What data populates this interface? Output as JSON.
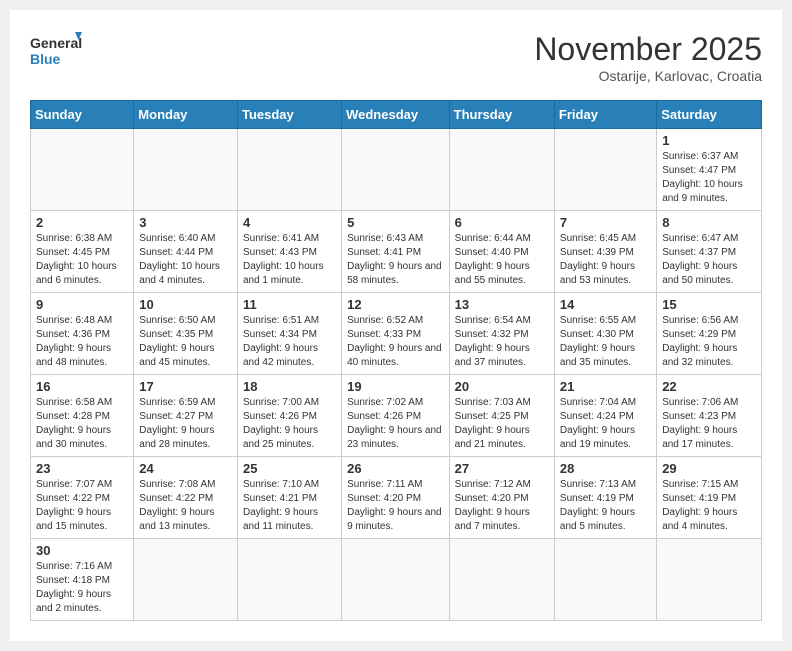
{
  "logo": {
    "text_general": "General",
    "text_blue": "Blue"
  },
  "header": {
    "month": "November 2025",
    "location": "Ostarije, Karlovac, Croatia"
  },
  "days_of_week": [
    "Sunday",
    "Monday",
    "Tuesday",
    "Wednesday",
    "Thursday",
    "Friday",
    "Saturday"
  ],
  "weeks": [
    [
      {
        "day": "",
        "info": ""
      },
      {
        "day": "",
        "info": ""
      },
      {
        "day": "",
        "info": ""
      },
      {
        "day": "",
        "info": ""
      },
      {
        "day": "",
        "info": ""
      },
      {
        "day": "",
        "info": ""
      },
      {
        "day": "1",
        "info": "Sunrise: 6:37 AM\nSunset: 4:47 PM\nDaylight: 10 hours and 9 minutes."
      }
    ],
    [
      {
        "day": "2",
        "info": "Sunrise: 6:38 AM\nSunset: 4:45 PM\nDaylight: 10 hours and 6 minutes."
      },
      {
        "day": "3",
        "info": "Sunrise: 6:40 AM\nSunset: 4:44 PM\nDaylight: 10 hours and 4 minutes."
      },
      {
        "day": "4",
        "info": "Sunrise: 6:41 AM\nSunset: 4:43 PM\nDaylight: 10 hours and 1 minute."
      },
      {
        "day": "5",
        "info": "Sunrise: 6:43 AM\nSunset: 4:41 PM\nDaylight: 9 hours and 58 minutes."
      },
      {
        "day": "6",
        "info": "Sunrise: 6:44 AM\nSunset: 4:40 PM\nDaylight: 9 hours and 55 minutes."
      },
      {
        "day": "7",
        "info": "Sunrise: 6:45 AM\nSunset: 4:39 PM\nDaylight: 9 hours and 53 minutes."
      },
      {
        "day": "8",
        "info": "Sunrise: 6:47 AM\nSunset: 4:37 PM\nDaylight: 9 hours and 50 minutes."
      }
    ],
    [
      {
        "day": "9",
        "info": "Sunrise: 6:48 AM\nSunset: 4:36 PM\nDaylight: 9 hours and 48 minutes."
      },
      {
        "day": "10",
        "info": "Sunrise: 6:50 AM\nSunset: 4:35 PM\nDaylight: 9 hours and 45 minutes."
      },
      {
        "day": "11",
        "info": "Sunrise: 6:51 AM\nSunset: 4:34 PM\nDaylight: 9 hours and 42 minutes."
      },
      {
        "day": "12",
        "info": "Sunrise: 6:52 AM\nSunset: 4:33 PM\nDaylight: 9 hours and 40 minutes."
      },
      {
        "day": "13",
        "info": "Sunrise: 6:54 AM\nSunset: 4:32 PM\nDaylight: 9 hours and 37 minutes."
      },
      {
        "day": "14",
        "info": "Sunrise: 6:55 AM\nSunset: 4:30 PM\nDaylight: 9 hours and 35 minutes."
      },
      {
        "day": "15",
        "info": "Sunrise: 6:56 AM\nSunset: 4:29 PM\nDaylight: 9 hours and 32 minutes."
      }
    ],
    [
      {
        "day": "16",
        "info": "Sunrise: 6:58 AM\nSunset: 4:28 PM\nDaylight: 9 hours and 30 minutes."
      },
      {
        "day": "17",
        "info": "Sunrise: 6:59 AM\nSunset: 4:27 PM\nDaylight: 9 hours and 28 minutes."
      },
      {
        "day": "18",
        "info": "Sunrise: 7:00 AM\nSunset: 4:26 PM\nDaylight: 9 hours and 25 minutes."
      },
      {
        "day": "19",
        "info": "Sunrise: 7:02 AM\nSunset: 4:26 PM\nDaylight: 9 hours and 23 minutes."
      },
      {
        "day": "20",
        "info": "Sunrise: 7:03 AM\nSunset: 4:25 PM\nDaylight: 9 hours and 21 minutes."
      },
      {
        "day": "21",
        "info": "Sunrise: 7:04 AM\nSunset: 4:24 PM\nDaylight: 9 hours and 19 minutes."
      },
      {
        "day": "22",
        "info": "Sunrise: 7:06 AM\nSunset: 4:23 PM\nDaylight: 9 hours and 17 minutes."
      }
    ],
    [
      {
        "day": "23",
        "info": "Sunrise: 7:07 AM\nSunset: 4:22 PM\nDaylight: 9 hours and 15 minutes."
      },
      {
        "day": "24",
        "info": "Sunrise: 7:08 AM\nSunset: 4:22 PM\nDaylight: 9 hours and 13 minutes."
      },
      {
        "day": "25",
        "info": "Sunrise: 7:10 AM\nSunset: 4:21 PM\nDaylight: 9 hours and 11 minutes."
      },
      {
        "day": "26",
        "info": "Sunrise: 7:11 AM\nSunset: 4:20 PM\nDaylight: 9 hours and 9 minutes."
      },
      {
        "day": "27",
        "info": "Sunrise: 7:12 AM\nSunset: 4:20 PM\nDaylight: 9 hours and 7 minutes."
      },
      {
        "day": "28",
        "info": "Sunrise: 7:13 AM\nSunset: 4:19 PM\nDaylight: 9 hours and 5 minutes."
      },
      {
        "day": "29",
        "info": "Sunrise: 7:15 AM\nSunset: 4:19 PM\nDaylight: 9 hours and 4 minutes."
      }
    ],
    [
      {
        "day": "30",
        "info": "Sunrise: 7:16 AM\nSunset: 4:18 PM\nDaylight: 9 hours and 2 minutes."
      },
      {
        "day": "",
        "info": ""
      },
      {
        "day": "",
        "info": ""
      },
      {
        "day": "",
        "info": ""
      },
      {
        "day": "",
        "info": ""
      },
      {
        "day": "",
        "info": ""
      },
      {
        "day": "",
        "info": ""
      }
    ]
  ]
}
